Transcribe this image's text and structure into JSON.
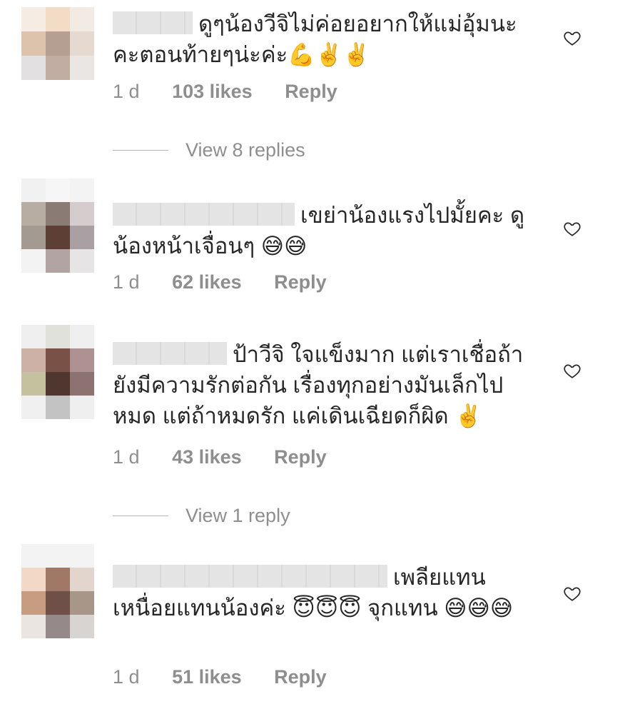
{
  "comments": [
    {
      "text": "ดูๆน้องวีจิไม่ค่อยอยากให้แม่อุ้มนะคะตอนท้ายๆน่ะค่ะ💪✌️✌️",
      "time": "1 d",
      "likes": "103 likes",
      "reply": "Reply",
      "avatar_colors": [
        "#f5ece3",
        "#f3dcc6",
        "#f2ebe3",
        "#ddc3ac",
        "#b59f93",
        "#e6d9cf",
        "#e2e0e0",
        "#c1ada1",
        "#eae6e3"
      ]
    },
    {
      "text": "เขย่าน้องแรงไปมั้ยคะ ดูน้องหน้าเจื่อนๆ 😅😅",
      "time": "1 d",
      "likes": "62 likes",
      "reply": "Reply",
      "avatar_colors": [
        "#f1f1f1",
        "#f6f6f6",
        "#f3f3f3",
        "#b7ada3",
        "#8a7b74",
        "#d5cdcd",
        "#a39b91",
        "#5d3f35",
        "#a8a0a3",
        "#f3f3f3",
        "#b3a4a4",
        "#e6e4e4"
      ]
    },
    {
      "text": "ป้าวีจิ ใจแข็งมาก แต่เราเชื่อถ้ายังมีความรักต่อกัน เรื่องทุกอย่างมันเล็กไปหมด แต่ถ้าหมดรัก แค่เดินเฉียดก็ผิด ✌️",
      "time": "1 d",
      "likes": "43 likes",
      "reply": "Reply",
      "avatar_colors": [
        "#efefef",
        "#e1e1dc",
        "#efefef",
        "#cdb0a6",
        "#7a5147",
        "#ad9291",
        "#c4c29e",
        "#4f362e",
        "#8c7271",
        "#f0f0f0",
        "#c3c3c3",
        "#efefef"
      ]
    },
    {
      "text": "เพลียแทนเหนื่อยแทนน้องค่ะ 😇😇😇 จุกแทน 😅😅😅",
      "time": "1 d",
      "likes": "51 likes",
      "reply": "Reply",
      "avatar_colors": [
        "#f3f3f3",
        "#f3f3f3",
        "#f3f3f3",
        "#f2d8c7",
        "#a17766",
        "#e1d5cd",
        "#c79d82",
        "#6f5048",
        "#a89688",
        "#ebe5e1",
        "#96898a",
        "#d8d4d1"
      ]
    }
  ],
  "view_replies": [
    {
      "label": "View 8 replies"
    },
    {
      "label": "View 1 reply"
    }
  ],
  "colors": {
    "muted": "#8e8e8e",
    "text": "#262626"
  },
  "icons": {
    "like": "heart-outline-icon"
  }
}
